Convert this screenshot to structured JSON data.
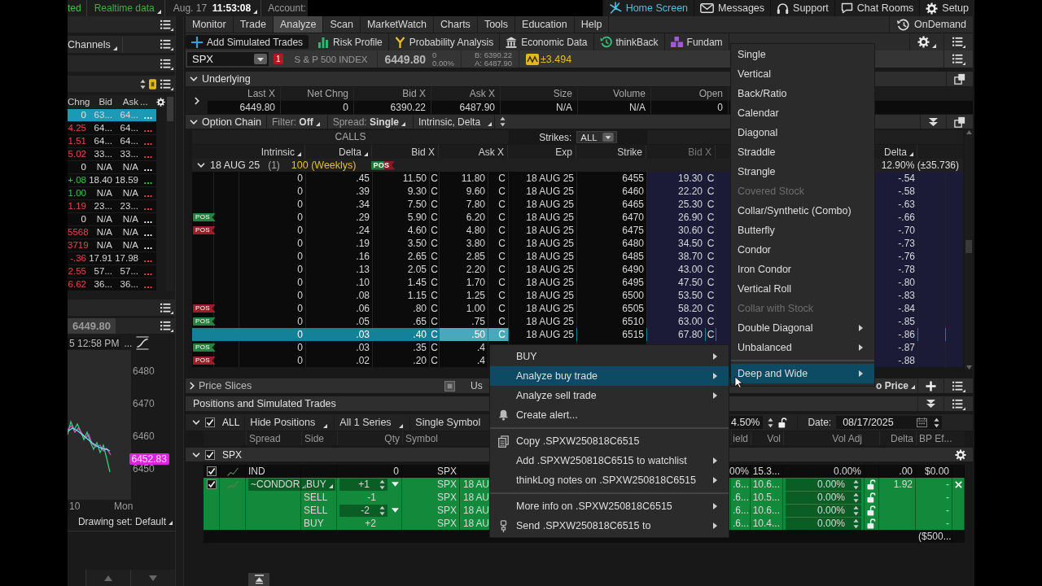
{
  "status_bar": {
    "connection": "ted",
    "feed": "Realtime data",
    "date": "Aug. 17",
    "time": "11:53:08",
    "account_label": "Account:",
    "links": [
      {
        "label": "Home Screen",
        "selected": true
      },
      {
        "label": "Messages",
        "selected": false
      },
      {
        "label": "Support",
        "selected": false
      },
      {
        "label": "Chat Rooms",
        "selected": false
      },
      {
        "label": "Setup",
        "selected": false
      }
    ]
  },
  "left_panel": {
    "channels_label": "Channels",
    "watchlist": {
      "columns": [
        "Chng",
        "Bid",
        "Ask",
        "..."
      ],
      "rows": [
        {
          "change": {
            "text": "0"
          },
          "bid": "63...",
          "ask": "64...",
          "more": {
            "text": "..."
          },
          "selected": true
        },
        {
          "change": {
            "text": "4.25",
            "color": "#e5484d"
          },
          "bid": "64...",
          "ask": "64...",
          "more": {
            "text": "...",
            "color": "#e5484d"
          },
          "selected": false
        },
        {
          "change": {
            "text": "1.51",
            "color": "#e5484d"
          },
          "bid": "64...",
          "ask": "64...",
          "more": {
            "text": "...",
            "color": "#e5484d"
          },
          "selected": false
        },
        {
          "change": {
            "text": "5.02",
            "color": "#e5484d"
          },
          "bid": "33...",
          "ask": "33...",
          "more": {
            "text": "...",
            "color": "#e5484d"
          },
          "selected": false
        },
        {
          "change": {
            "text": "0"
          },
          "bid": "N/A",
          "ask": "N/A",
          "more": {
            "text": "..."
          },
          "selected": false
        },
        {
          "change": {
            "text": "+.08",
            "color": "#3cc24a"
          },
          "bid": "18.40",
          "ask": "18.59",
          "more": {
            "text": "...",
            "color": "#3cc24a"
          },
          "selected": false
        },
        {
          "change": {
            "text": "1.00",
            "color": "#3cc24a"
          },
          "bid": "N/A",
          "ask": "N/A",
          "more": {
            "text": "...",
            "color": "#e5484d"
          },
          "selected": false
        },
        {
          "change": {
            "text": "1.19",
            "color": "#e5484d"
          },
          "bid": "23...",
          "ask": "23...",
          "more": {
            "text": "...",
            "color": "#e5484d"
          },
          "selected": false
        },
        {
          "change": {
            "text": "0"
          },
          "bid": "N/A",
          "ask": "N/A",
          "more": {
            "text": "..."
          },
          "selected": false
        },
        {
          "change": {
            "text": "5568",
            "color": "#e5484d"
          },
          "bid": "N/A",
          "ask": "N/A",
          "more": {
            "text": "..."
          },
          "selected": false
        },
        {
          "change": {
            "text": "3719",
            "color": "#e5484d"
          },
          "bid": "N/A",
          "ask": "N/A",
          "more": {
            "text": "..."
          },
          "selected": false
        },
        {
          "change": {
            "text": "-.36",
            "color": "#e5484d"
          },
          "bid": "17.91",
          "ask": "17.98",
          "more": {
            "text": "...",
            "color": "#e5484d"
          },
          "selected": false
        },
        {
          "change": {
            "text": "2.55",
            "color": "#e5484d"
          },
          "bid": "57...",
          "ask": "57...",
          "more": {
            "text": "...",
            "color": "#e5484d"
          },
          "selected": false
        },
        {
          "change": {
            "text": "6.62",
            "color": "#e5484d"
          },
          "bid": "36...",
          "ask": "36...",
          "more": {
            "text": "...",
            "color": "#e5484d"
          },
          "selected": false
        }
      ]
    },
    "chart": {
      "last_price": "6449.80",
      "timestamp": "5 12:58 PM",
      "more": "...",
      "price_labels": [
        "6480",
        "6470",
        "6460",
        "6450"
      ],
      "current_price": "6452.83",
      "time_labels": [
        "10",
        "Mon"
      ],
      "drawing_set": "Drawing set: Default"
    }
  },
  "main_tabs": [
    {
      "label": "Monitor",
      "selected": false
    },
    {
      "label": "Trade",
      "selected": false
    },
    {
      "label": "Analyze",
      "selected": true
    },
    {
      "label": "Scan",
      "selected": false
    },
    {
      "label": "MarketWatch",
      "selected": false
    },
    {
      "label": "Charts",
      "selected": false
    },
    {
      "label": "Tools",
      "selected": false
    },
    {
      "label": "Education",
      "selected": false
    },
    {
      "label": "Help",
      "selected": false
    }
  ],
  "on_demand": "OnDemand",
  "analyze_tabs": [
    {
      "label": "Add Simulated Trades",
      "selected": true
    },
    {
      "label": "Risk Profile",
      "selected": false
    },
    {
      "label": "Probability Analysis",
      "selected": false
    },
    {
      "label": "Economic Data",
      "selected": false
    },
    {
      "label": "thinkBack",
      "selected": false
    },
    {
      "label": "Fundam",
      "selected": false
    }
  ],
  "symbol_bar": {
    "symbol": "SPX",
    "alert_count": "1",
    "description": "S & P 500 INDEX",
    "last": "6449.80",
    "net_change": "0",
    "percent_change": "0.00%",
    "bid": "B: 6390.22",
    "ask": "A: 6487.90",
    "expected_move": "±3.494"
  },
  "underlying": {
    "title": "Underlying",
    "expanded": true,
    "columns": [
      "Last X",
      "Net Chng",
      "Bid X",
      "Ask X",
      "Size",
      "Volume",
      "Open"
    ],
    "values": [
      "6449.80",
      "0",
      "6390.22",
      "6487.90",
      "N/A",
      "N/A",
      "0"
    ]
  },
  "option_chain": {
    "title": "Option Chain",
    "expanded": true,
    "filter_label": "Filter:",
    "filter": "Off",
    "spread_label": "Spread:",
    "spread": "Single",
    "fields": "Intrinsic, Delta",
    "calls_label": "CALLS",
    "strikes_label": "Strikes:",
    "strikes": "ALL",
    "call_columns": [
      "Intrinsic",
      "Delta",
      "Bid X",
      "Ask X"
    ],
    "middle_columns": [
      "Exp",
      "Strike"
    ],
    "put_columns": [
      "Bid X",
      "Delta"
    ],
    "series": {
      "expanded": true,
      "expiry": "18 AUG 25",
      "count": "(1)",
      "multiplier": "100 (Weeklys)",
      "tag": "POS",
      "implied_move": "12.90% (±35.736)"
    },
    "rows": [
      {
        "selected": false,
        "intrinsic": "0",
        "delta": ".45",
        "bid": "11.50",
        "bid_exch": "C",
        "ask": "11.80",
        "ask_exch": "C",
        "exp": "18 AUG 25",
        "strike": "6455",
        "put_bid": "19.30",
        "put_bid_exch": "C",
        "put_delta": "-.54"
      },
      {
        "selected": false,
        "intrinsic": "0",
        "delta": ".39",
        "bid": "9.30",
        "bid_exch": "C",
        "ask": "9.60",
        "ask_exch": "C",
        "exp": "18 AUG 25",
        "strike": "6460",
        "put_bid": "22.20",
        "put_bid_exch": "C",
        "put_delta": "-.58"
      },
      {
        "selected": false,
        "intrinsic": "0",
        "delta": ".34",
        "bid": "7.50",
        "bid_exch": "C",
        "ask": "7.80",
        "ask_exch": "C",
        "exp": "18 AUG 25",
        "strike": "6465",
        "put_bid": "25.30",
        "put_bid_exch": "C",
        "put_delta": "-.63"
      },
      {
        "tag": {
          "text": "POS",
          "color": "#23843f"
        },
        "selected": false,
        "intrinsic": "0",
        "delta": ".29",
        "bid": "5.90",
        "bid_exch": "C",
        "ask": "6.20",
        "ask_exch": "C",
        "exp": "18 AUG 25",
        "strike": "6470",
        "put_bid": "26.90",
        "put_bid_exch": "C",
        "put_delta": "-.66"
      },
      {
        "tag": {
          "text": "POS",
          "color": "#9e1c27"
        },
        "selected": false,
        "intrinsic": "0",
        "delta": ".24",
        "bid": "4.60",
        "bid_exch": "C",
        "ask": "4.80",
        "ask_exch": "C",
        "exp": "18 AUG 25",
        "strike": "6475",
        "put_bid": "30.60",
        "put_bid_exch": "C",
        "put_delta": "-.70"
      },
      {
        "selected": false,
        "intrinsic": "0",
        "delta": ".19",
        "bid": "3.50",
        "bid_exch": "C",
        "ask": "3.80",
        "ask_exch": "C",
        "exp": "18 AUG 25",
        "strike": "6480",
        "put_bid": "34.50",
        "put_bid_exch": "C",
        "put_delta": "-.73"
      },
      {
        "selected": false,
        "intrinsic": "0",
        "delta": ".16",
        "bid": "2.65",
        "bid_exch": "C",
        "ask": "2.85",
        "ask_exch": "C",
        "exp": "18 AUG 25",
        "strike": "6485",
        "put_bid": "38.70",
        "put_bid_exch": "C",
        "put_delta": "-.76"
      },
      {
        "selected": false,
        "intrinsic": "0",
        "delta": ".13",
        "bid": "2.05",
        "bid_exch": "C",
        "ask": "2.20",
        "ask_exch": "C",
        "exp": "18 AUG 25",
        "strike": "6490",
        "put_bid": "43.00",
        "put_bid_exch": "C",
        "put_delta": "-.78"
      },
      {
        "selected": false,
        "intrinsic": "0",
        "delta": ".10",
        "bid": "1.45",
        "bid_exch": "C",
        "ask": "1.70",
        "ask_exch": "C",
        "exp": "18 AUG 25",
        "strike": "6495",
        "put_bid": "47.50",
        "put_bid_exch": "C",
        "put_delta": "-.80"
      },
      {
        "selected": false,
        "intrinsic": "0",
        "delta": ".08",
        "bid": "1.15",
        "bid_exch": "C",
        "ask": "1.25",
        "ask_exch": "C",
        "exp": "18 AUG 25",
        "strike": "6500",
        "put_bid": "53.50",
        "put_bid_exch": "C",
        "put_delta": "-.83"
      },
      {
        "tag": {
          "text": "POS",
          "color": "#9e1c27"
        },
        "selected": false,
        "intrinsic": "0",
        "delta": ".06",
        "bid": ".80",
        "bid_exch": "C",
        "ask": "1.00",
        "ask_exch": "C",
        "exp": "18 AUG 25",
        "strike": "6505",
        "put_bid": "58.20",
        "put_bid_exch": "C",
        "put_delta": "-.84"
      },
      {
        "tag": {
          "text": "POS",
          "color": "#23843f"
        },
        "selected": false,
        "intrinsic": "0",
        "delta": ".05",
        "bid": ".65",
        "bid_exch": "C",
        "ask": ".75",
        "ask_exch": "C",
        "exp": "18 AUG 25",
        "strike": "6510",
        "put_bid": "63.00",
        "put_bid_exch": "C",
        "put_delta": "-.85"
      },
      {
        "selected": true,
        "intrinsic": "0",
        "delta": ".03",
        "bid": ".40",
        "bid_exch": "C",
        "ask": ".50",
        "ask_exch": "C",
        "exp": "18 AUG 25",
        "strike": "6515",
        "put_bid": "67.80",
        "put_bid_exch": "C",
        "put_delta": "-.86"
      },
      {
        "tag": {
          "text": "POS",
          "color": "#23843f"
        },
        "selected": false,
        "intrinsic": "0",
        "delta": ".03",
        "bid": ".35",
        "bid_exch": "C",
        "ask": ".4",
        "put_delta": "-.87"
      },
      {
        "tag": {
          "text": "POS",
          "color": "#9e1c27"
        },
        "selected": false,
        "intrinsic": "0",
        "delta": ".02",
        "bid": ".20",
        "bid_exch": "C",
        "ask": ".4",
        "put_delta": "-.88"
      }
    ]
  },
  "price_slices": {
    "title": "Price Slices",
    "expanded": false,
    "toggle_label": "Us",
    "mode": "o Price"
  },
  "positions": {
    "title": "Positions and Simulated Trades",
    "expanded": true,
    "all_checked": true,
    "all_label": "ALL",
    "hide_positions": "Hide Positions",
    "series": "All 1 Series",
    "symbol_mode": "Single Symbol",
    "rate": "4.50%",
    "rate_locked": false,
    "date_label": "Date:",
    "date": "08/17/2025",
    "columns": [
      "Spread",
      "Side",
      "Qty",
      "Symbol",
      "ield",
      "Vol",
      "Vol Adj",
      "Delta",
      "BP Ef..."
    ],
    "group": {
      "symbol": "SPX",
      "checked": true,
      "expanded": true
    },
    "rows": [
      {
        "checked": true,
        "simulated": false,
        "removable": false,
        "spread": "IND",
        "legs": [
          {
            "qty": "0",
            "editable": false,
            "symbol": "SPX",
            "yield": "00%",
            "vol": "15.3...",
            "vol_adj": "0.00%",
            "delta": ".00",
            "bp": "$0.00"
          }
        ]
      },
      {
        "checked": true,
        "simulated": true,
        "removable": true,
        "spread": "~CONDOR",
        "legs": [
          {
            "side": "BUY",
            "qty": "+1",
            "editable": true,
            "symbol": "SPX",
            "exp": "18 AU",
            "yield": ".6...",
            "vol": "10.6...",
            "vol_adj": "0.00%",
            "vol_locked": false,
            "delta": "1.92",
            "bp": "-"
          },
          {
            "side": "SELL",
            "qty": "-1",
            "editable": false,
            "symbol": "SPX",
            "exp": "18 AU",
            "yield": ".6...",
            "vol": "10.5...",
            "vol_adj": "0.00%",
            "vol_locked": false,
            "bp": "-"
          },
          {
            "side": "SELL",
            "qty": "-2",
            "editable": true,
            "symbol": "SPX",
            "exp": "18 AU",
            "yield": ".6...",
            "vol": "10.6...",
            "vol_adj": "0.00%",
            "vol_locked": false,
            "bp": "-"
          },
          {
            "side": "BUY",
            "qty": "+2",
            "editable": false,
            "symbol": "SPX",
            "exp": "18 AU",
            "yield": ".6...",
            "vol": "10.4...",
            "vol_adj": "0.00%",
            "vol_locked": false,
            "bp": "-"
          }
        ]
      }
    ],
    "total_bp": "($500..."
  },
  "context_menu": {
    "groups": [
      [
        {
          "label": "BUY",
          "submenu": true,
          "selected": false
        },
        {
          "label": "Analyze buy trade",
          "submenu": true,
          "selected": true
        },
        {
          "label": "Analyze sell trade",
          "submenu": true,
          "selected": false
        },
        {
          "label": "Create alert...",
          "submenu": false,
          "selected": false
        }
      ],
      [
        {
          "label": "Copy .SPXW250818C6515",
          "submenu": false,
          "selected": false
        },
        {
          "label": "Add .SPXW250818C6515 to watchlist",
          "submenu": true,
          "selected": false
        },
        {
          "label": "thinkLog notes on .SPXW250818C6515",
          "submenu": true,
          "selected": false
        }
      ],
      [
        {
          "label": "More info on .SPXW250818C6515",
          "submenu": true,
          "selected": false
        },
        {
          "label": "Send .SPXW250818C6515 to",
          "submenu": true,
          "selected": false
        }
      ]
    ]
  },
  "strategy_menu": {
    "groups": [
      [
        {
          "label": "Single",
          "disabled": false,
          "submenu": false,
          "selected": false
        },
        {
          "label": "Vertical",
          "disabled": false,
          "submenu": false,
          "selected": false
        },
        {
          "label": "Back/Ratio",
          "disabled": false,
          "submenu": false,
          "selected": false
        },
        {
          "label": "Calendar",
          "disabled": false,
          "submenu": false,
          "selected": false
        },
        {
          "label": "Diagonal",
          "disabled": false,
          "submenu": false,
          "selected": false
        },
        {
          "label": "Straddle",
          "disabled": false,
          "submenu": false,
          "selected": false
        },
        {
          "label": "Strangle",
          "disabled": false,
          "submenu": false,
          "selected": false
        },
        {
          "label": "Covered Stock",
          "disabled": true,
          "submenu": false,
          "selected": false
        },
        {
          "label": "Collar/Synthetic (Combo)",
          "disabled": false,
          "submenu": false,
          "selected": false
        },
        {
          "label": "Butterfly",
          "disabled": false,
          "submenu": false,
          "selected": false
        },
        {
          "label": "Condor",
          "disabled": false,
          "submenu": false,
          "selected": false
        },
        {
          "label": "Iron Condor",
          "disabled": false,
          "submenu": false,
          "selected": false
        },
        {
          "label": "Vertical Roll",
          "disabled": false,
          "submenu": false,
          "selected": false
        },
        {
          "label": "Collar with Stock",
          "disabled": true,
          "submenu": false,
          "selected": false
        },
        {
          "label": "Double Diagonal",
          "disabled": false,
          "submenu": true,
          "selected": false
        },
        {
          "label": "Unbalanced",
          "disabled": false,
          "submenu": true,
          "selected": false
        }
      ],
      [
        {
          "label": "Deep and Wide",
          "disabled": false,
          "submenu": true,
          "selected": true
        }
      ]
    ]
  }
}
